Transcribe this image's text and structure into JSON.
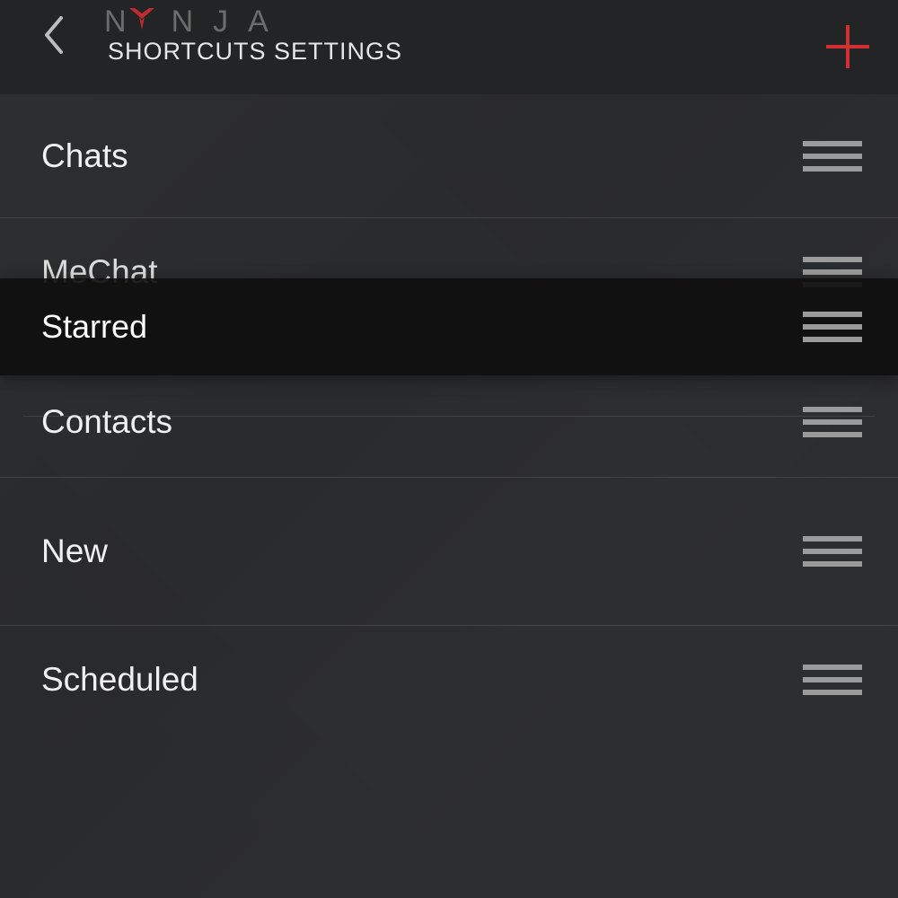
{
  "header": {
    "brand_letters": [
      "N",
      "N",
      "J",
      "A"
    ],
    "subtitle": "SHORTCUTS SETTINGS"
  },
  "colors": {
    "accent": "#d12f33",
    "brand_letter": "#6c6c6c",
    "handle": "#9b9b9b"
  },
  "shortcuts": {
    "items": [
      {
        "label": "Chats"
      },
      {
        "label": "MeChat"
      },
      {
        "label": "Contacts"
      },
      {
        "label": "New"
      },
      {
        "label": "Scheduled"
      }
    ],
    "dragging": {
      "label": "Starred"
    }
  }
}
